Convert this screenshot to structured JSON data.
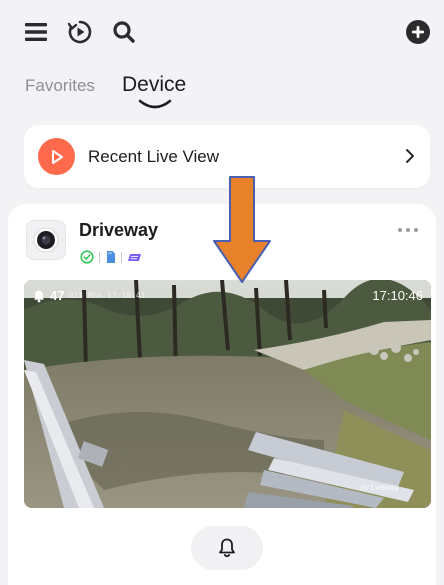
{
  "tabs": {
    "favorites": "Favorites",
    "device": "Device"
  },
  "recent_live_view": {
    "label": "Recent Live View"
  },
  "device": {
    "name": "Driveway",
    "live_view": {
      "alert_count": "47",
      "osd_timestamp": "023 Mon 17:10:41",
      "time": "17:10:46",
      "watermark": "driveway"
    }
  },
  "colors": {
    "accent": "#ff6a4d",
    "status_ok": "#34c759",
    "sd_card": "#4a90e2",
    "cloud": "#7b61ff",
    "annotation_arrow": "#e8822a"
  }
}
